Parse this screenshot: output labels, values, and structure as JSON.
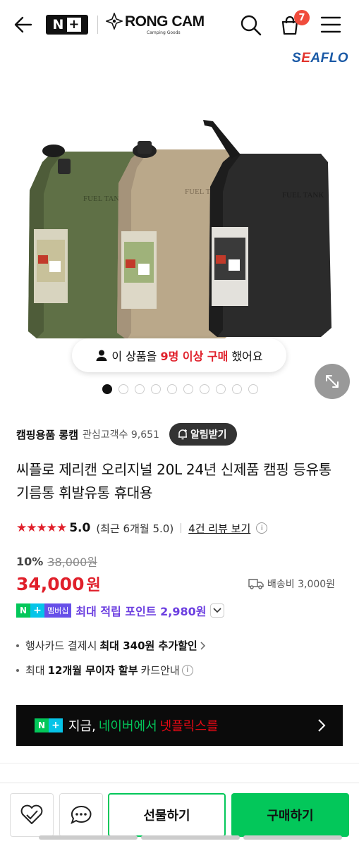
{
  "header": {
    "np_logo_text": "N",
    "np_logo_plus": "+",
    "store_logo_name": "RONG CAM",
    "store_logo_sub": "Camping Goods",
    "cart_count": "7"
  },
  "brand_logo": {
    "prefix": "S",
    "e": "E",
    "suffix": "AFLO"
  },
  "gallery": {
    "purchase_prefix": "이 상품을",
    "purchase_highlight": "9명 이상 구매",
    "purchase_suffix": "했어요",
    "dot_count": 10,
    "active_dot": 0
  },
  "store": {
    "name": "캠핑용품 롱캠",
    "followers_label": "관심고객수 9,651",
    "alert_button": "알림받기"
  },
  "product": {
    "title": "씨플로 제리캔 오리지널 20L 24년 신제품 캠핑 등유통 기름통 휘발유통 휴대용",
    "stars": "★★★★★",
    "score": "5.0",
    "recent_rating": "(최근 6개월 5.0)",
    "reviews_link": "4건 리뷰 보기",
    "discount": "10%",
    "original_price": "38,000원",
    "price": "34,000",
    "price_unit": "원",
    "shipping": "배송비 3,000원"
  },
  "points": {
    "badge_n": "N",
    "badge_plus": "+",
    "badge_member": "멤버십",
    "text": "최대 적립 포인트 2,980원"
  },
  "benefits": {
    "card_prefix": "행사카드 결제시",
    "card_bold": "최대 340원 추가할인",
    "install_prefix": "최대",
    "install_bold": "12개월 무이자 할부",
    "install_suffix": "카드안내"
  },
  "banner": {
    "now": "지금,",
    "naver": "네이버에서",
    "netflix": "넷플릭스를"
  },
  "bottom": {
    "gift_label": "선물하기",
    "buy_label": "구매하기"
  },
  "product_image": {
    "cans": [
      {
        "color": "#5e6f45",
        "label": "FUEL TANK"
      },
      {
        "color": "#b9a889",
        "label": "FUEL TANK"
      },
      {
        "color": "#2a2a2a",
        "label": "FUEL TANK"
      }
    ]
  },
  "colors": {
    "accent_green": "#03c75a",
    "price_red": "#e0202b",
    "points_purple": "#6c3fe0"
  }
}
